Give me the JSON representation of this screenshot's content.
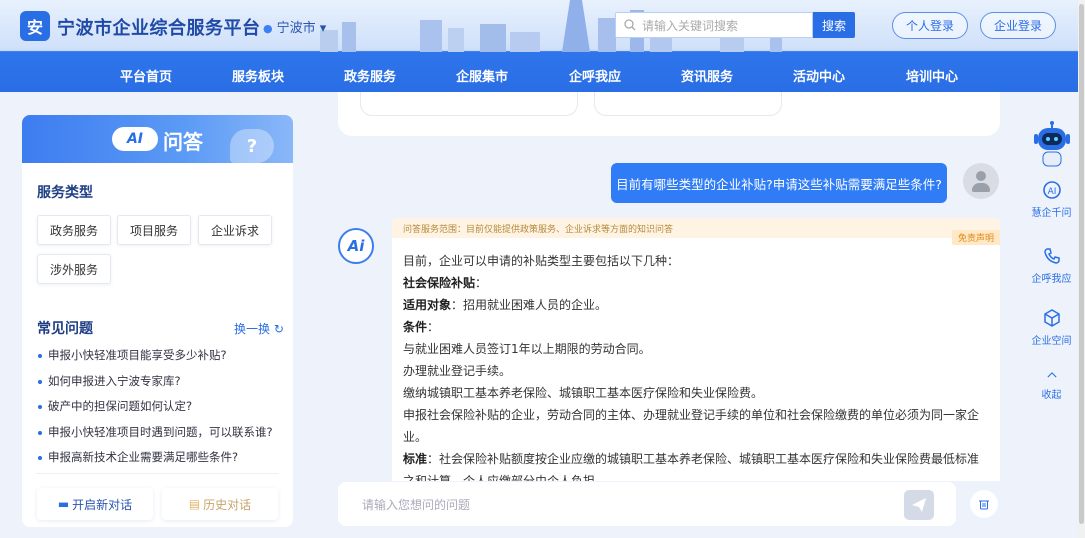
{
  "header": {
    "logo_glyph": "安",
    "site_title": "宁波市企业综合服务平台",
    "city": "宁波市",
    "search_placeholder": "请输入关键词搜索",
    "search_button": "搜索",
    "personal_login": "个人登录",
    "enterprise_login": "企业登录"
  },
  "nav": [
    "平台首页",
    "服务板块",
    "政务服务",
    "企服集市",
    "企呼我应",
    "资讯服务",
    "活动中心",
    "培训中心"
  ],
  "left": {
    "ai_badge": "AI",
    "ai_title": "问答",
    "service_types_title": "服务类型",
    "service_types": [
      "政务服务",
      "项目服务",
      "企业诉求",
      "涉外服务"
    ],
    "faq_title": "常见问题",
    "refresh_label": "换一换",
    "faq": [
      "申报小快轻准项目能享受多少补贴?",
      "如何申报进入宁波专家库?",
      "破产中的担保问题如何认定?",
      "申报小快轻准项目时遇到问题，可以联系谁?",
      "申报高新技术企业需要满足哪些条件?"
    ],
    "new_chat": "开启新对话",
    "history": "历史对话"
  },
  "chat": {
    "user_message": "目前有哪些类型的企业补贴?申请这些补贴需要满足些条件?",
    "bot_avatar_label": "Ai",
    "scope_note": "问答服务范围：目前仅能提供政策服务、企业诉求等方面的知识问答",
    "disclaimer": "免责声明",
    "answer": {
      "intro": "目前，企业可以申请的补贴类型主要包括以下几种：",
      "subsidy_title": "社会保险补贴",
      "target_label": "适用对象",
      "target_text": "：招用就业困难人员的企业。",
      "conditions_label": "条件",
      "cond1": "与就业困难人员签订1年以上期限的劳动合同。",
      "cond2": "办理就业登记手续。",
      "cond3": "缴纳城镇职工基本养老保险、城镇职工基本医疗保险和失业保险费。",
      "cond4a": "申报社会保险补贴的企业，劳动合同的主体、办理就业登记手续的单位和社会保险缴费的单位必须为同一家企",
      "cond4b": "业。",
      "standard_label": "标准",
      "standard_a": "：社会保险补贴额度按企业应缴的城镇职工基本养老保险、城镇职工基本医疗保险和失业保险费最低标准",
      "standard_b": "之和计算，个人应缴部分由个人负担。"
    },
    "input_placeholder": "请输入您想问的问题"
  },
  "rail": {
    "items": [
      "慧企千问",
      "企呼我应",
      "企业空间",
      "收起"
    ]
  },
  "colors": {
    "primary": "#2a6ee6",
    "user_bubble": "#2f7cf6",
    "disclaimer": "#e08a1a"
  }
}
